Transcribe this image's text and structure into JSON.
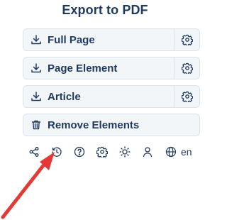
{
  "header": {
    "title": "Export to PDF"
  },
  "buttons": [
    {
      "label": "Full Page",
      "icon": "download-icon",
      "has_settings": true
    },
    {
      "label": "Page Element",
      "icon": "download-icon",
      "has_settings": true
    },
    {
      "label": "Article",
      "icon": "download-icon",
      "has_settings": true
    },
    {
      "label": "Remove Elements",
      "icon": "trash-icon",
      "has_settings": false
    }
  ],
  "toolbar": {
    "icons": [
      "share-icon",
      "history-icon",
      "help-icon",
      "settings-icon",
      "theme-sun-icon",
      "user-icon",
      "globe-icon"
    ],
    "language": "en"
  },
  "colors": {
    "text": "#1e3a5f",
    "button_bg": "#f3f6f9",
    "button_border": "#dde3ea",
    "annotation_arrow": "#e53935"
  }
}
